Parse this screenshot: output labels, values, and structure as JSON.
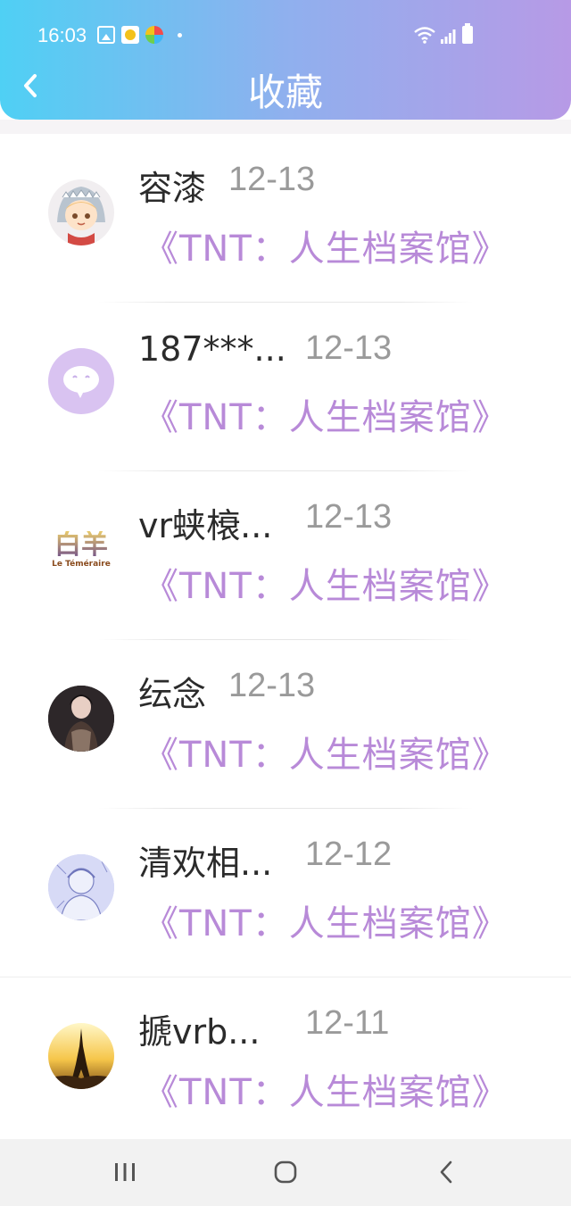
{
  "status_bar": {
    "time": "16:03",
    "icons": [
      "gallery-icon",
      "app-notification-icon",
      "color-app-icon",
      "notification-dot-icon",
      "wifi-icon",
      "signal-icon",
      "battery-icon"
    ]
  },
  "header": {
    "title": "收藏",
    "back_icon": "chevron-left-icon"
  },
  "favorites": [
    {
      "name": "容漆",
      "date": "12-13",
      "title": "《TNT：人生档案馆》",
      "avatar": "cartoon-shark-hoodie-avatar"
    },
    {
      "name": "187***...",
      "date": "12-13",
      "title": "《TNT：人生档案馆》",
      "avatar": "default-chat-bubble-avatar"
    },
    {
      "name": "vr蛱榱...",
      "date": "12-13",
      "title": "《TNT：人生档案馆》",
      "avatar": "logo-avatar"
    },
    {
      "name": "纭念",
      "date": "12-13",
      "title": "《TNT：人生档案馆》",
      "avatar": "photo-avatar"
    },
    {
      "name": "清欢相...",
      "date": "12-12",
      "title": "《TNT：人生档案馆》",
      "avatar": "sketch-avatar"
    },
    {
      "name": "搋vrb...",
      "date": "12-11",
      "title": "《TNT：人生档案馆》",
      "avatar": "eiffel-tower-avatar"
    }
  ],
  "avatar_logo_text": {
    "main": "白羊",
    "sub": "Le Téméraire"
  },
  "colors": {
    "header_gradient_start": "#4fd0f4",
    "header_gradient_end": "#b79ae6",
    "title_accent": "#b88ad8",
    "date_gray": "#9a9a9a"
  },
  "nav_bar": {
    "icons": [
      "recent-apps-icon",
      "home-icon",
      "back-icon"
    ]
  }
}
